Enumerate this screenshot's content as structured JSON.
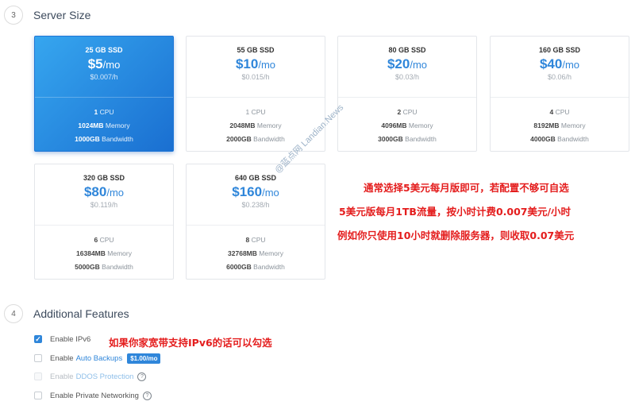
{
  "server_size": {
    "step": "3",
    "title": "Server Size",
    "plans": [
      {
        "ssd": "25 GB SSD",
        "price": "$5",
        "per": "/mo",
        "hourly": "$0.007/h",
        "cpu": "1",
        "cpu_label": "CPU",
        "memory": "1024MB",
        "memory_label": "Memory",
        "bandwidth": "1000GB",
        "bandwidth_label": "Bandwidth",
        "selected": true
      },
      {
        "ssd": "55 GB SSD",
        "price": "$10",
        "per": "/mo",
        "hourly": "$0.015/h",
        "cpu": "1",
        "cpu_label": "CPU",
        "memory": "2048MB",
        "memory_label": "Memory",
        "bandwidth": "2000GB",
        "bandwidth_label": "Bandwidth"
      },
      {
        "ssd": "80 GB SSD",
        "price": "$20",
        "per": "/mo",
        "hourly": "$0.03/h",
        "cpu": "2",
        "cpu_label": "CPU",
        "memory": "4096MB",
        "memory_label": "Memory",
        "bandwidth": "3000GB",
        "bandwidth_label": "Bandwidth"
      },
      {
        "ssd": "160 GB SSD",
        "price": "$40",
        "per": "/mo",
        "hourly": "$0.06/h",
        "cpu": "4",
        "cpu_label": "CPU",
        "memory": "8192MB",
        "memory_label": "Memory",
        "bandwidth": "4000GB",
        "bandwidth_label": "Bandwidth"
      },
      {
        "ssd": "320 GB SSD",
        "price": "$80",
        "per": "/mo",
        "hourly": "$0.119/h",
        "cpu": "6",
        "cpu_label": "CPU",
        "memory": "16384MB",
        "memory_label": "Memory",
        "bandwidth": "5000GB",
        "bandwidth_label": "Bandwidth"
      },
      {
        "ssd": "640 GB SSD",
        "price": "$160",
        "per": "/mo",
        "hourly": "$0.238/h",
        "cpu": "8",
        "cpu_label": "CPU",
        "memory": "32768MB",
        "memory_label": "Memory",
        "bandwidth": "6000GB",
        "bandwidth_label": "Bandwidth"
      }
    ]
  },
  "annotations": {
    "line1": "通常选择5美元每月版即可，若配置不够可自选",
    "line2": "5美元版每月1TB流量，按小时计费0.007美元/小时",
    "line3": "例如你只使用10小时就删除服务器，则收取0.07美元",
    "ipv6_note": "如果你家宽带支持IPv6的话可以勾选"
  },
  "watermark": "@蓝点网 Landian.News",
  "additional_features": {
    "step": "4",
    "title": "Additional Features",
    "enable_ipv6": {
      "label": "Enable IPv6",
      "checked": true
    },
    "auto_backups": {
      "prefix": "Enable",
      "link": "Auto Backups",
      "badge": "$1.00/mo",
      "checked": false
    },
    "ddos": {
      "prefix": "Enable",
      "link": "DDOS Protection",
      "disabled": true
    },
    "private_networking": {
      "label": "Enable Private Networking",
      "checked": false
    }
  },
  "colors": {
    "accent": "#2f86da",
    "annotation_red": "#e41d1d"
  },
  "icons": {
    "checkbox_checked": "check-icon",
    "help": "question-circle-icon"
  }
}
